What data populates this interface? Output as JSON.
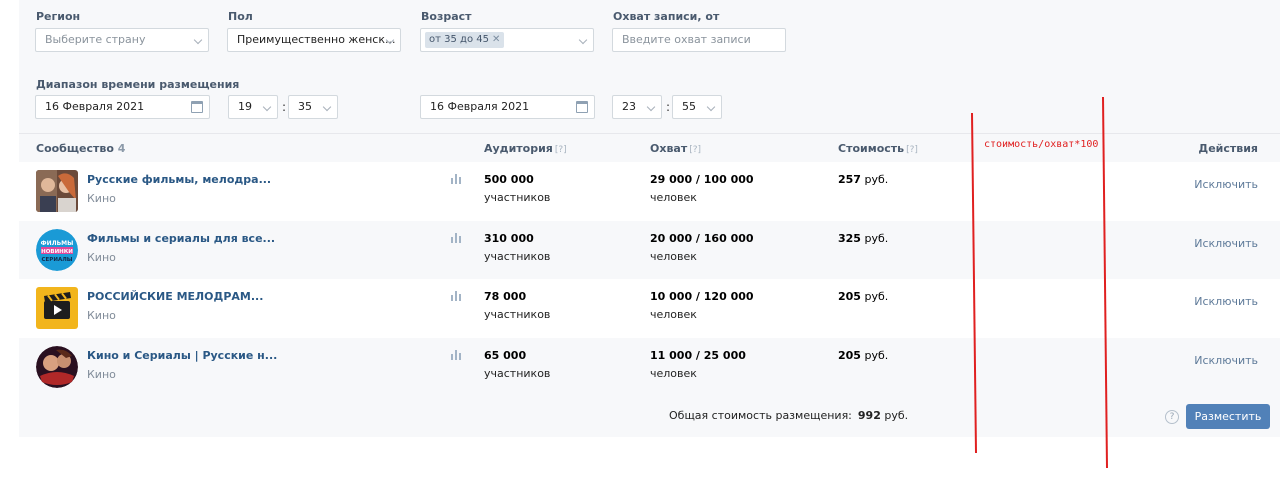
{
  "filters": {
    "region": {
      "label": "Регион",
      "placeholder": "Выберите страну"
    },
    "gender": {
      "label": "Пол",
      "value": "Преимущественно женск..."
    },
    "age": {
      "label": "Возраст",
      "tag": "от 35 до 45",
      "tag_remove": "✕"
    },
    "reach": {
      "label": "Охват записи, от",
      "placeholder": "Введите охват записи"
    },
    "time_range": {
      "label": "Диапазон времени размещения",
      "start_date": "16 Февраля 2021",
      "start_hour": "19",
      "start_minute": "35",
      "end_date": "16 Февраля 2021",
      "end_hour": "23",
      "end_minute": "55",
      "separator": ":"
    }
  },
  "table": {
    "headers": {
      "community": "Сообщество",
      "community_count": "4",
      "audience": "Аудитория",
      "reach": "Охват",
      "cost": "Стоимость",
      "help_mark": "[?]",
      "actions": "Действия"
    },
    "rows": [
      {
        "name": "Русские фильмы, мелодра...",
        "category": "Кино",
        "audience": "500 000",
        "audience_unit": "участников",
        "reach": "29 000 / 100 000",
        "reach_unit": "человек",
        "cost": "257",
        "currency": "руб.",
        "action": "Исключить"
      },
      {
        "name": "Фильмы и сериалы для все...",
        "category": "Кино",
        "audience": "310 000",
        "audience_unit": "участников",
        "reach": "20 000 / 160 000",
        "reach_unit": "человек",
        "cost": "325",
        "currency": "руб.",
        "action": "Исключить"
      },
      {
        "name": "РОССИЙСКИЕ МЕЛОДРАМ...",
        "category": "Кино",
        "audience": "78 000",
        "audience_unit": "участников",
        "reach": "10 000 / 120 000",
        "reach_unit": "человек",
        "cost": "205",
        "currency": "руб.",
        "action": "Исключить"
      },
      {
        "name": "Кино и Сериалы | Русские н...",
        "category": "Кино",
        "audience": "65 000",
        "audience_unit": "участников",
        "reach": "11 000 / 25 000",
        "reach_unit": "человек",
        "cost": "205",
        "currency": "руб.",
        "action": "Исключить"
      }
    ]
  },
  "footer": {
    "total_label": "Общая стоимость размещения:",
    "total_value": "992",
    "currency": "руб.",
    "help": "?",
    "place_button": "Разместить"
  },
  "annotation": {
    "text": "стоимость/охват*100",
    "color": "#e02020"
  },
  "colors": {
    "accent": "#5181b8",
    "link": "#2a5885",
    "annotation_red": "#e02020"
  },
  "icons": [
    "chevron-down-icon",
    "calendar-icon",
    "close-icon",
    "stats-icon",
    "help-icon"
  ]
}
